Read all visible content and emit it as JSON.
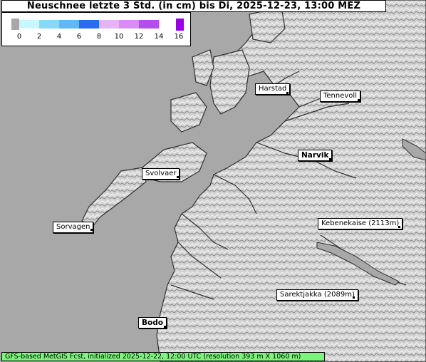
{
  "title": "Neuschnee letzte 3 Std. (in cm) bis Di, 2025-12-23, 13:00 MEZ",
  "legend": {
    "ticks": [
      "0",
      "2",
      "4",
      "6",
      "8",
      "10",
      "12",
      "14",
      "16"
    ],
    "colors": [
      "#c8f8ff",
      "#88d8f8",
      "#60b8f8",
      "#2a6cf0",
      "#e6b4f5",
      "#d98cf5",
      "#b24ef0",
      "#9a00e6"
    ]
  },
  "places": [
    {
      "name": "Harstad"
    },
    {
      "name": "Tennevoll"
    },
    {
      "name": "Narvik"
    },
    {
      "name": "Svolvaer"
    },
    {
      "name": "Sorvagen"
    },
    {
      "name": "Kebenekaise (2113m)"
    },
    {
      "name": "Sarektjakka (2089m)"
    },
    {
      "name": "Bodo"
    }
  ],
  "footer": "GFS-based MetGIS Fcst, initialized 2025-12-22, 12:00 UTC  (resolution 393 m X 1060 m)"
}
